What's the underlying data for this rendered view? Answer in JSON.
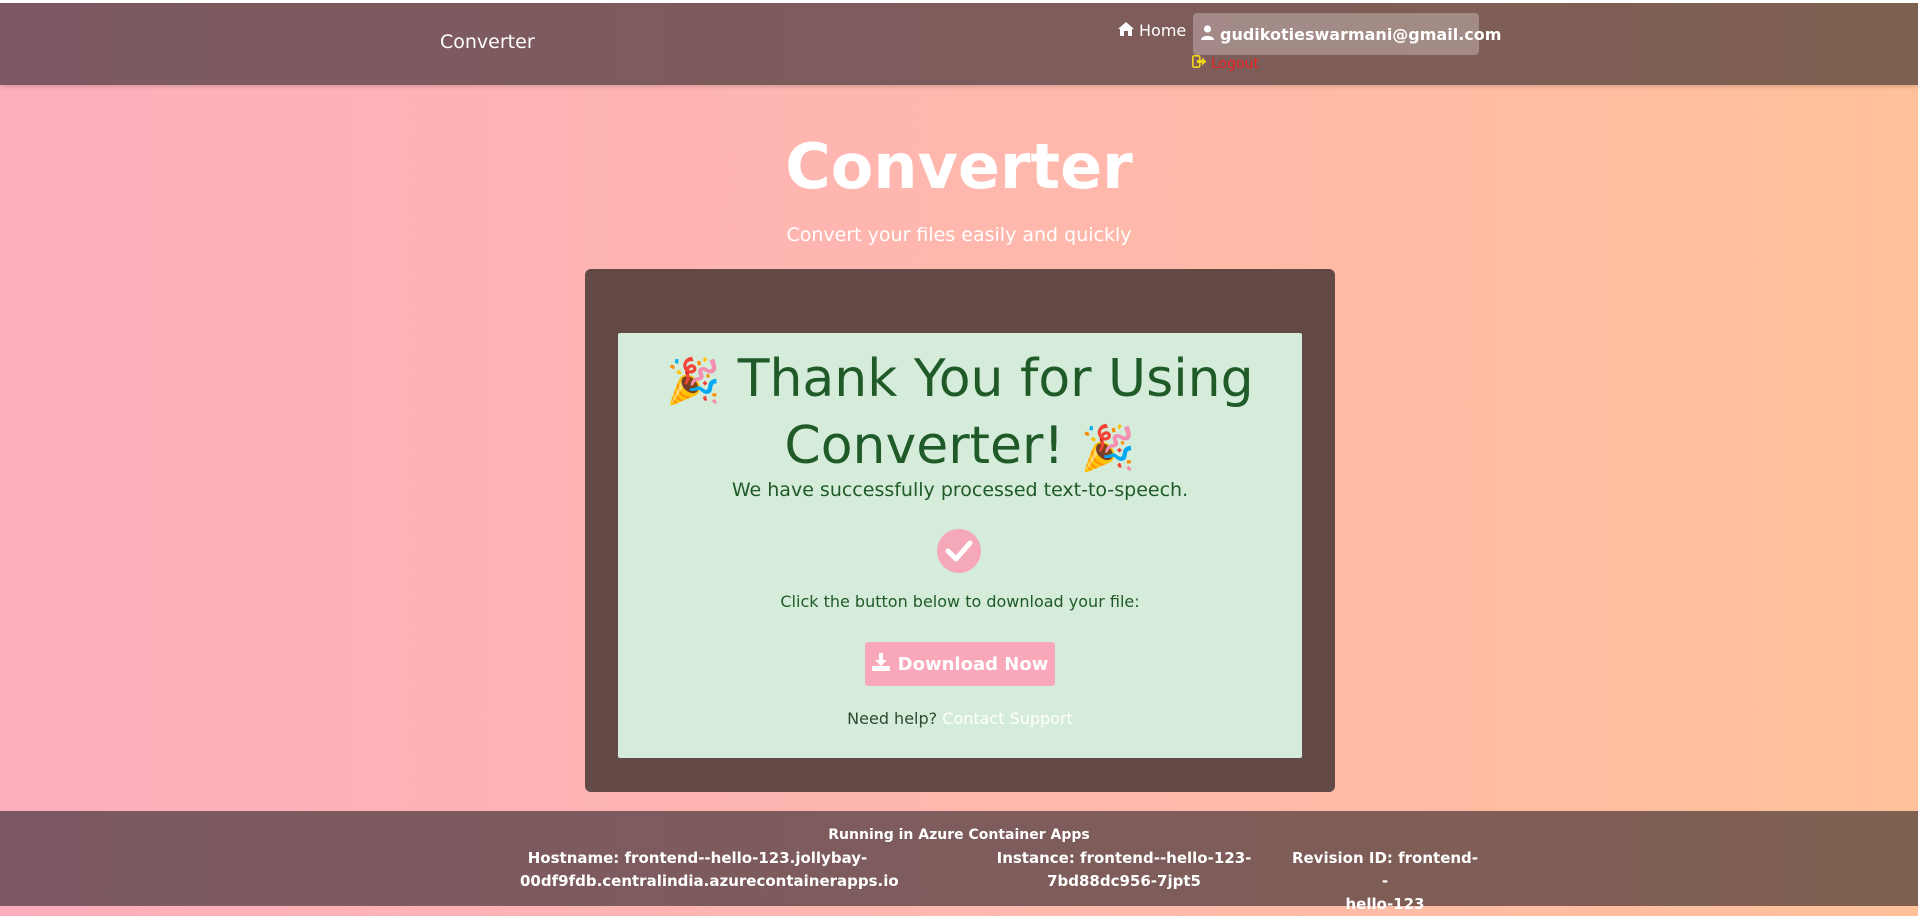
{
  "header": {
    "brand": "Converter",
    "home_label": "Home",
    "user_email": "gudikotieswarmani@gmail.com",
    "logout_label": "Logout"
  },
  "hero": {
    "title": "Converter",
    "subtitle": "Convert your files easily and quickly"
  },
  "result": {
    "thanks_line1": "Thank You for Using",
    "thanks_line2": "Converter!",
    "processed": "We have successfully processed text-to-speech.",
    "click_text": "Click the button below to download your file:",
    "download_label": "Download Now",
    "help_prefix": "Need help?",
    "help_link": "Contact Support"
  },
  "footer": {
    "running": "Running in Azure Container Apps",
    "hostname_line1": "Hostname: frontend--hello-123.jollybay-",
    "hostname_line2": "00df9fdb.centralindia.azurecontainerapps.io",
    "instance_line1": "Instance: frontend--hello-123-",
    "instance_line2": "7bd88dc956-7jpt5",
    "revision_line1": "Revision ID: frontend--",
    "revision_line2": "hello-123"
  },
  "icons": {
    "home": "home-icon",
    "user": "user-icon",
    "logout": "logout-icon",
    "party": "party-popper-icon",
    "check": "check-circle-icon",
    "download": "download-icon"
  },
  "colors": {
    "header_bg": "#7c5962",
    "card_bg": "#644a47",
    "success_bg": "#d4ecd9",
    "success_text": "#1f5a28",
    "accent_pink": "#f8a8b8",
    "logout_red": "#e8201e"
  }
}
